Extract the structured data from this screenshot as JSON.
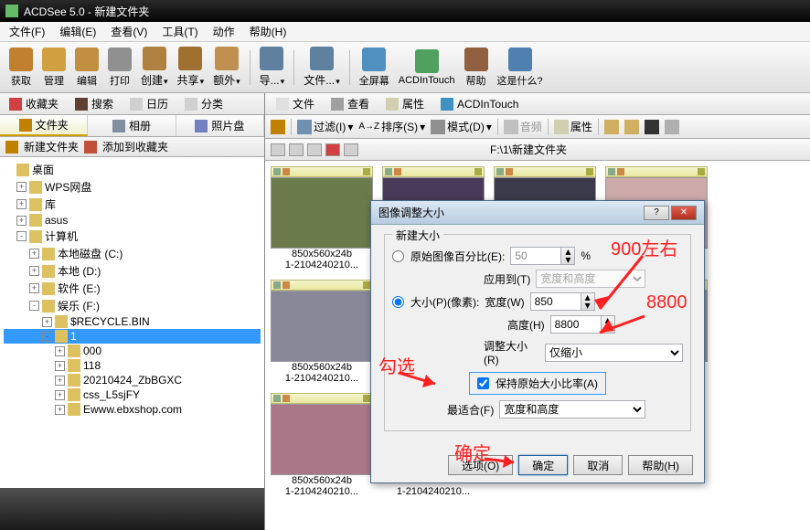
{
  "title": "ACDSee 5.0 - 新建文件夹",
  "menu": [
    "文件(F)",
    "编辑(E)",
    "查看(V)",
    "工具(T)",
    "动作",
    "帮助(H)"
  ],
  "toolbar": [
    {
      "label": "获取"
    },
    {
      "label": "管理"
    },
    {
      "label": "编辑"
    },
    {
      "label": "打印"
    },
    {
      "label": "创建"
    },
    {
      "label": "共享"
    },
    {
      "label": "额外"
    }
  ],
  "toolbar2": [
    {
      "label": "导..."
    },
    {
      "label": "文件..."
    },
    {
      "label": "全屏幕"
    },
    {
      "label": "ACDInTouch"
    },
    {
      "label": "帮助"
    },
    {
      "label": "这是什么?"
    }
  ],
  "leftTabs": [
    {
      "label": "收藏夹"
    },
    {
      "label": "搜索"
    },
    {
      "label": "日历"
    },
    {
      "label": "分类"
    }
  ],
  "subTabs": [
    {
      "label": "文件夹"
    },
    {
      "label": "相册"
    },
    {
      "label": "照片盘"
    }
  ],
  "favRow": {
    "new": "新建文件夹",
    "add": "添加到收藏夹"
  },
  "rightTopTabs": [
    {
      "label": "文件"
    },
    {
      "label": "查看"
    },
    {
      "label": "属性"
    },
    {
      "label": "ACDInTouch"
    }
  ],
  "rtool": {
    "filter": "过滤(I)",
    "sort": "排序(S)",
    "mode": "模式(D)",
    "audio": "音频",
    "prop": "属性"
  },
  "path": "F:\\1\\新建文件夹",
  "tree": [
    {
      "label": "桌面",
      "ind": 0,
      "exp": ""
    },
    {
      "label": "WPS网盘",
      "ind": 1,
      "exp": "+"
    },
    {
      "label": "库",
      "ind": 1,
      "exp": "+"
    },
    {
      "label": "asus",
      "ind": 1,
      "exp": "+"
    },
    {
      "label": "计算机",
      "ind": 1,
      "exp": "-"
    },
    {
      "label": "本地磁盘 (C:)",
      "ind": 2,
      "exp": "+"
    },
    {
      "label": "本地 (D:)",
      "ind": 2,
      "exp": "+"
    },
    {
      "label": "软件 (E:)",
      "ind": 2,
      "exp": "+"
    },
    {
      "label": "娱乐 (F:)",
      "ind": 2,
      "exp": "-"
    },
    {
      "label": "$RECYCLE.BIN",
      "ind": 3,
      "exp": "+"
    },
    {
      "label": "1",
      "ind": 3,
      "exp": "-",
      "sel": true
    },
    {
      "label": "000",
      "ind": 4,
      "exp": "+"
    },
    {
      "label": "118",
      "ind": 4,
      "exp": "+"
    },
    {
      "label": "20210424_ZbBGXC",
      "ind": 4,
      "exp": "+"
    },
    {
      "label": "css_L5sjFY",
      "ind": 4,
      "exp": "+"
    },
    {
      "label": "Ewww.ebxshop.com",
      "ind": 4,
      "exp": "+"
    }
  ],
  "thumbDim": "850x560x24b",
  "thumbFn": "1-2104240210...",
  "dialog": {
    "title": "图像调整大小",
    "group": "新建大小",
    "optPct": "原始图像百分比(E):",
    "pctVal": "50",
    "pctUnit": "%",
    "applyTo": "应用到(T)",
    "applyVal": "宽度和高度",
    "optSize": "大小(P)(像素):",
    "width": "宽度(W)",
    "widthVal": "850",
    "height": "高度(H)",
    "heightVal": "8800",
    "resize": "调整大小(R)",
    "resizeVal": "仅缩小",
    "keepRatio": "保持原始大小比率(A)",
    "fit": "最适合(F)",
    "fitVal": "宽度和高度",
    "options": "选项(O)",
    "ok": "确定",
    "cancel": "取消",
    "help": "帮助(H)"
  },
  "anno": {
    "a1": "900左右",
    "a2": "8800",
    "a3": "勾选",
    "a4": "确定"
  }
}
